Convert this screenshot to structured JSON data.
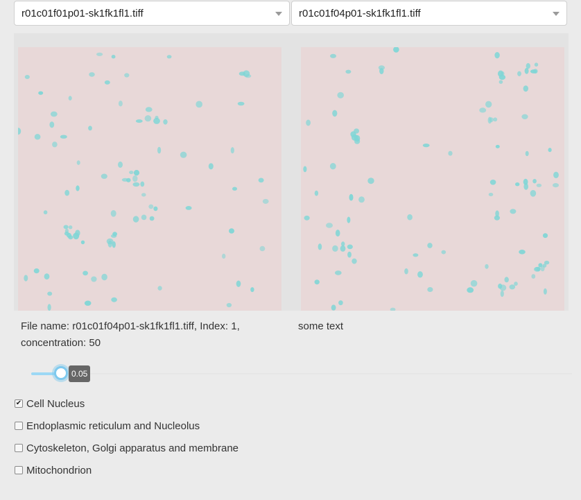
{
  "selects": {
    "left": {
      "value": "r01c01f01p01-sk1fk1fl1.tiff"
    },
    "right": {
      "value": "r01c01f04p01-sk1fk1fl1.tiff"
    }
  },
  "images": {
    "background": "#e8d8d8",
    "cell_color": "#7fd6d6"
  },
  "captions": {
    "left": "File name: r01c01f04p01-sk1fk1fl1.tiff, Index: 1, concentration: 50",
    "right": "some text"
  },
  "slider": {
    "value_label": "0.05",
    "fraction": 0.055,
    "accent": "#7ec9ee"
  },
  "channels": [
    {
      "label": "Cell Nucleus",
      "checked": true
    },
    {
      "label": "Endoplasmic reticulum and Nucleolus",
      "checked": false
    },
    {
      "label": "Cytoskeleton, Golgi apparatus and membrane",
      "checked": false
    },
    {
      "label": "Mitochondrion",
      "checked": false
    }
  ]
}
